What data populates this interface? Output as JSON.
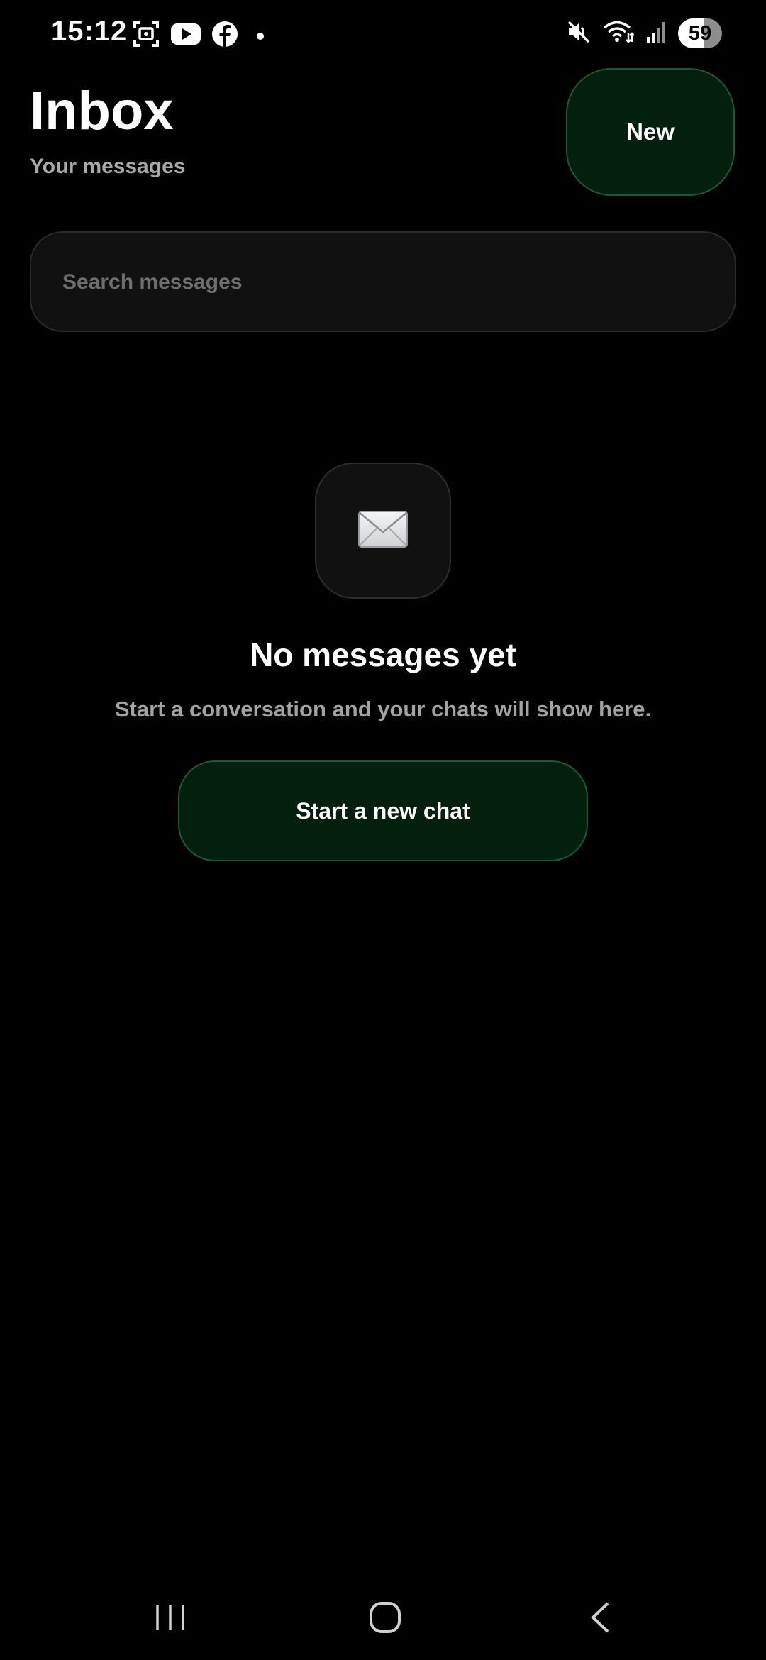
{
  "status_bar": {
    "time": "15:12",
    "battery_level": "59",
    "left_icons": [
      "screenshot-icon",
      "youtube-icon",
      "facebook-icon",
      "notification-dot-icon"
    ],
    "right_icons": [
      "mute-icon",
      "wifi-icon",
      "signal-icon",
      "battery-icon"
    ]
  },
  "header": {
    "title": "Inbox",
    "subtitle": "Your messages",
    "new_button_label": "New"
  },
  "search": {
    "placeholder": "Search messages",
    "value": ""
  },
  "empty_state": {
    "icon": "envelope-icon",
    "title": "No messages yet",
    "subtitle": "Start a conversation and your chats will show here.",
    "button_label": "Start a new chat"
  },
  "nav_bar": {
    "buttons": [
      "recent-apps-icon",
      "home-icon",
      "back-icon"
    ]
  },
  "colors": {
    "background": "#000000",
    "accent_fill": "#03200f",
    "accent_border": "#1a5a33",
    "muted_text": "#a8a8a8",
    "surface": "#111111"
  }
}
